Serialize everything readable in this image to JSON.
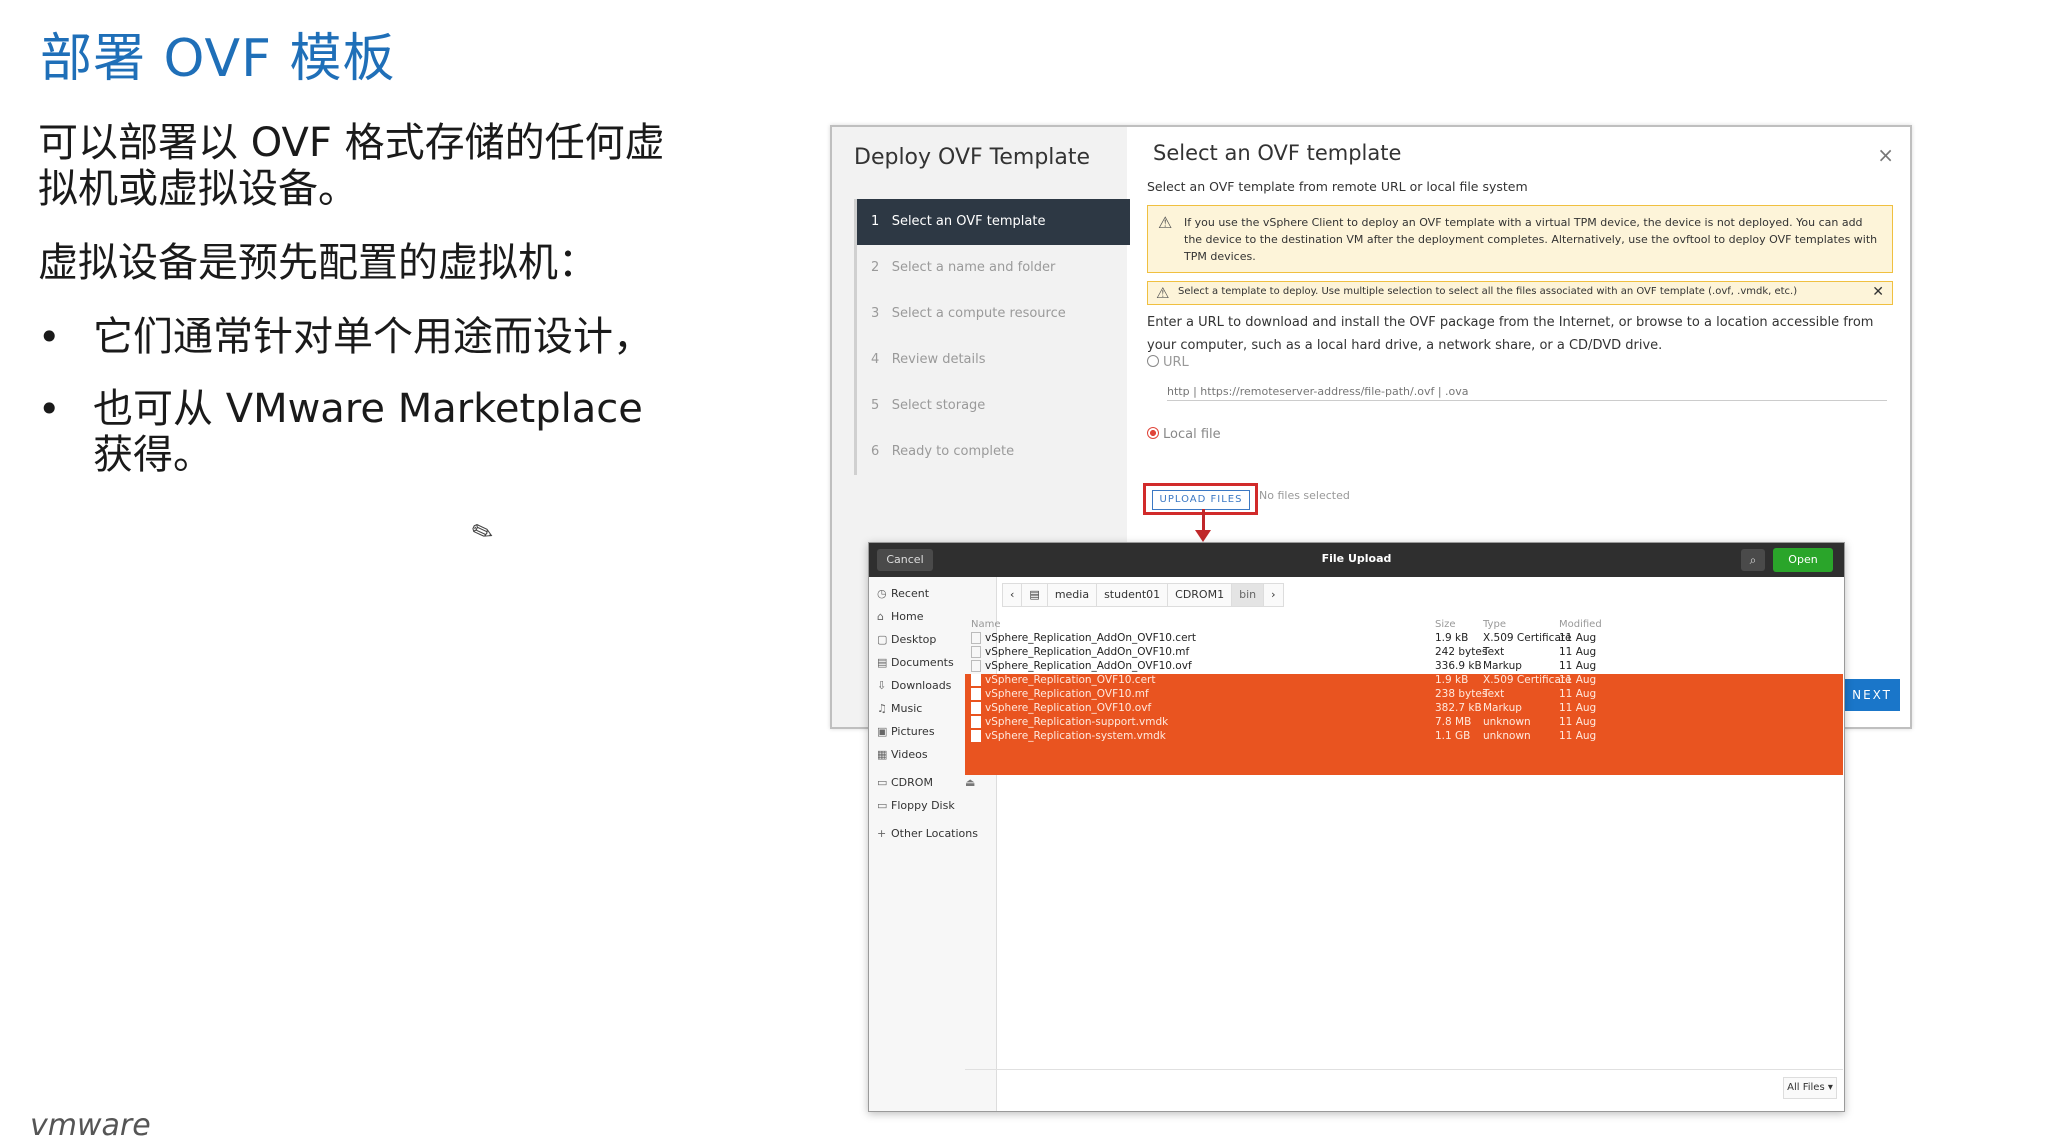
{
  "slide": {
    "title": "部署 OVF 模板",
    "para1": "可以部署以 OVF 格式存储的任何虚拟机或虚拟设备。",
    "para2": "虚拟设备是预先配置的虚拟机：",
    "bullets": [
      "它们通常针对单个用途而设计，",
      "也可从 VMware Marketplace 获得。"
    ],
    "logo": "vmware"
  },
  "dialog": {
    "left_title": "Deploy OVF Template",
    "steps": [
      {
        "num": "1",
        "label": "Select an OVF template"
      },
      {
        "num": "2",
        "label": "Select a name and folder"
      },
      {
        "num": "3",
        "label": "Select a compute resource"
      },
      {
        "num": "4",
        "label": "Review details"
      },
      {
        "num": "5",
        "label": "Select storage"
      },
      {
        "num": "6",
        "label": "Ready to complete"
      }
    ],
    "title": "Select an OVF template",
    "close": "×",
    "subtitle": "Select an OVF template from remote URL or local file system",
    "warning_tpm": "If you use the vSphere Client to deploy an OVF template with a virtual TPM device, the device is not deployed. You can add the device to the destination VM after the deployment completes. Alternatively, use the ovftool to deploy OVF templates with TPM devices.",
    "warning_select": "Select a template to deploy. Use multiple selection to select all the files associated with an OVF template (.ovf, .vmdk, etc.)",
    "description": "Enter a URL to download and install the OVF package from the Internet, or browse to a location accessible from your computer, such as a local hard drive, a network share, or a CD/DVD drive.",
    "url_label": "URL",
    "url_placeholder": "http | https://remoteserver-address/file-path/.ovf | .ova",
    "local_label": "Local file",
    "upload_label": "UPLOAD FILES",
    "no_files": "No files selected",
    "next_label": "NEXT",
    "warning_icon": "warning-triangle-icon"
  },
  "file_dialog": {
    "cancel": "Cancel",
    "title": "File Upload",
    "open": "Open",
    "places": [
      {
        "icon": "recent-icon",
        "label": "Recent"
      },
      {
        "icon": "home-icon",
        "label": "Home"
      },
      {
        "icon": "desktop-icon",
        "label": "Desktop"
      },
      {
        "icon": "documents-icon",
        "label": "Documents"
      },
      {
        "icon": "downloads-icon",
        "label": "Downloads"
      },
      {
        "icon": "music-icon",
        "label": "Music"
      },
      {
        "icon": "pictures-icon",
        "label": "Pictures"
      },
      {
        "icon": "videos-icon",
        "label": "Videos"
      },
      {
        "icon": "drive-icon",
        "label": "CDROM"
      },
      {
        "icon": "drive-icon",
        "label": "Floppy Disk"
      },
      {
        "icon": "plus-icon",
        "label": "Other Locations"
      }
    ],
    "breadcrumbs": [
      "media",
      "student01",
      "CDROM1",
      "bin"
    ],
    "columns": {
      "name": "Name",
      "size": "Size",
      "type": "Type",
      "modified": "Modified"
    },
    "files": [
      {
        "name": "vSphere_Replication_AddOn_OVF10.cert",
        "size": "1.9 kB",
        "type": "X.509 Certificate",
        "modified": "11 Aug",
        "selected": false
      },
      {
        "name": "vSphere_Replication_AddOn_OVF10.mf",
        "size": "242 bytes",
        "type": "Text",
        "modified": "11 Aug",
        "selected": false
      },
      {
        "name": "vSphere_Replication_AddOn_OVF10.ovf",
        "size": "336.9 kB",
        "type": "Markup",
        "modified": "11 Aug",
        "selected": false
      },
      {
        "name": "vSphere_Replication_OVF10.cert",
        "size": "1.9 kB",
        "type": "X.509 Certificate",
        "modified": "11 Aug",
        "selected": true
      },
      {
        "name": "vSphere_Replication_OVF10.mf",
        "size": "238 bytes",
        "type": "Text",
        "modified": "11 Aug",
        "selected": true
      },
      {
        "name": "vSphere_Replication_OVF10.ovf",
        "size": "382.7 kB",
        "type": "Markup",
        "modified": "11 Aug",
        "selected": true
      },
      {
        "name": "vSphere_Replication-support.vmdk",
        "size": "7.8 MB",
        "type": "unknown",
        "modified": "11 Aug",
        "selected": true
      },
      {
        "name": "vSphere_Replication-system.vmdk",
        "size": "1.1 GB",
        "type": "unknown",
        "modified": "11 Aug",
        "selected": true
      }
    ],
    "filter": "All Files ▾"
  },
  "colors": {
    "accent": "#1f6fb8",
    "selection": "#e95420",
    "highlight_box": "#d12a2a",
    "dialog_dark": "#2d3844"
  }
}
